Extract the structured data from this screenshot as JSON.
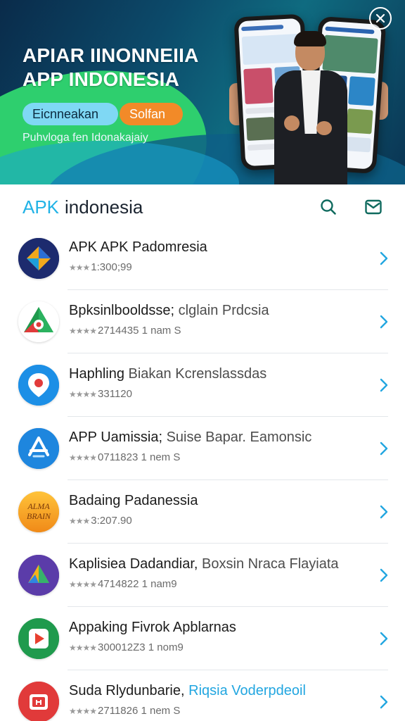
{
  "banner": {
    "title_line1": "APIAR IINONNEIIA",
    "title_line2": "APP INDONESIA",
    "pill_primary": "Eicnneakan",
    "pill_secondary": "Solfan",
    "subtitle": "Puhvloga fen Idonakajaiy",
    "close_icon": "close-icon",
    "colors": {
      "pill_primary_bg": "#7fd8f4",
      "pill_secondary_bg": "#f28a28",
      "green_wave": "#2ecf6e"
    }
  },
  "header": {
    "logo_prefix": "APK",
    "logo_brand": "indonesia",
    "search_icon": "search-icon",
    "mail_icon": "mail-icon",
    "accent_color": "#22b3e6",
    "icon_color": "#0f6a5e"
  },
  "apps": [
    {
      "name": "APK APK Padomresia",
      "subtitle": "",
      "subtitle_accent": false,
      "stars": "★★★",
      "meta": "1:300;99",
      "icon": "diamond-play-icon"
    },
    {
      "name": "Bpksinlbooldsse;",
      "subtitle": "clglain Prdcsia",
      "subtitle_accent": false,
      "stars": "★★★★",
      "meta": "2714435 1 nam S",
      "icon": "green-triangle-icon"
    },
    {
      "name": "Haphling",
      "subtitle": "Biakan Kcrenslassdas",
      "subtitle_accent": false,
      "stars": "★★★★",
      "meta": "331120",
      "icon": "location-pin-icon"
    },
    {
      "name": "APP Uamissia;",
      "subtitle": "Suise Bapar. Eamonsic",
      "subtitle_accent": false,
      "stars": "★★★★",
      "meta": "0711823 1 nem S",
      "icon": "app-store-icon"
    },
    {
      "name": "Badaing Padanessia",
      "subtitle": "",
      "subtitle_accent": false,
      "stars": "★★★",
      "meta": "3:207.90",
      "icon": "brain-badge-icon",
      "icon_text_top": "ALMA",
      "icon_text_bottom": "BRAIN"
    },
    {
      "name": "Kaplisiea Dadandiar,",
      "subtitle": "Boxsin Nraca Flayiata",
      "subtitle_accent": false,
      "stars": "★★★★",
      "meta": "4714822 1 nam9",
      "icon": "purple-play-icon"
    },
    {
      "name": "Appaking Fivrok Apblarnas",
      "subtitle": "",
      "subtitle_accent": false,
      "stars": "★★★★",
      "meta": "300012Z3 1 nom9",
      "icon": "green-play-icon"
    },
    {
      "name": "Suda Rlydunbarie,",
      "subtitle": "Riqsia Voderpdeoil",
      "subtitle_accent": true,
      "stars": "★★★★",
      "meta": "2711826 1 nem S",
      "icon": "red-bag-icon"
    }
  ]
}
